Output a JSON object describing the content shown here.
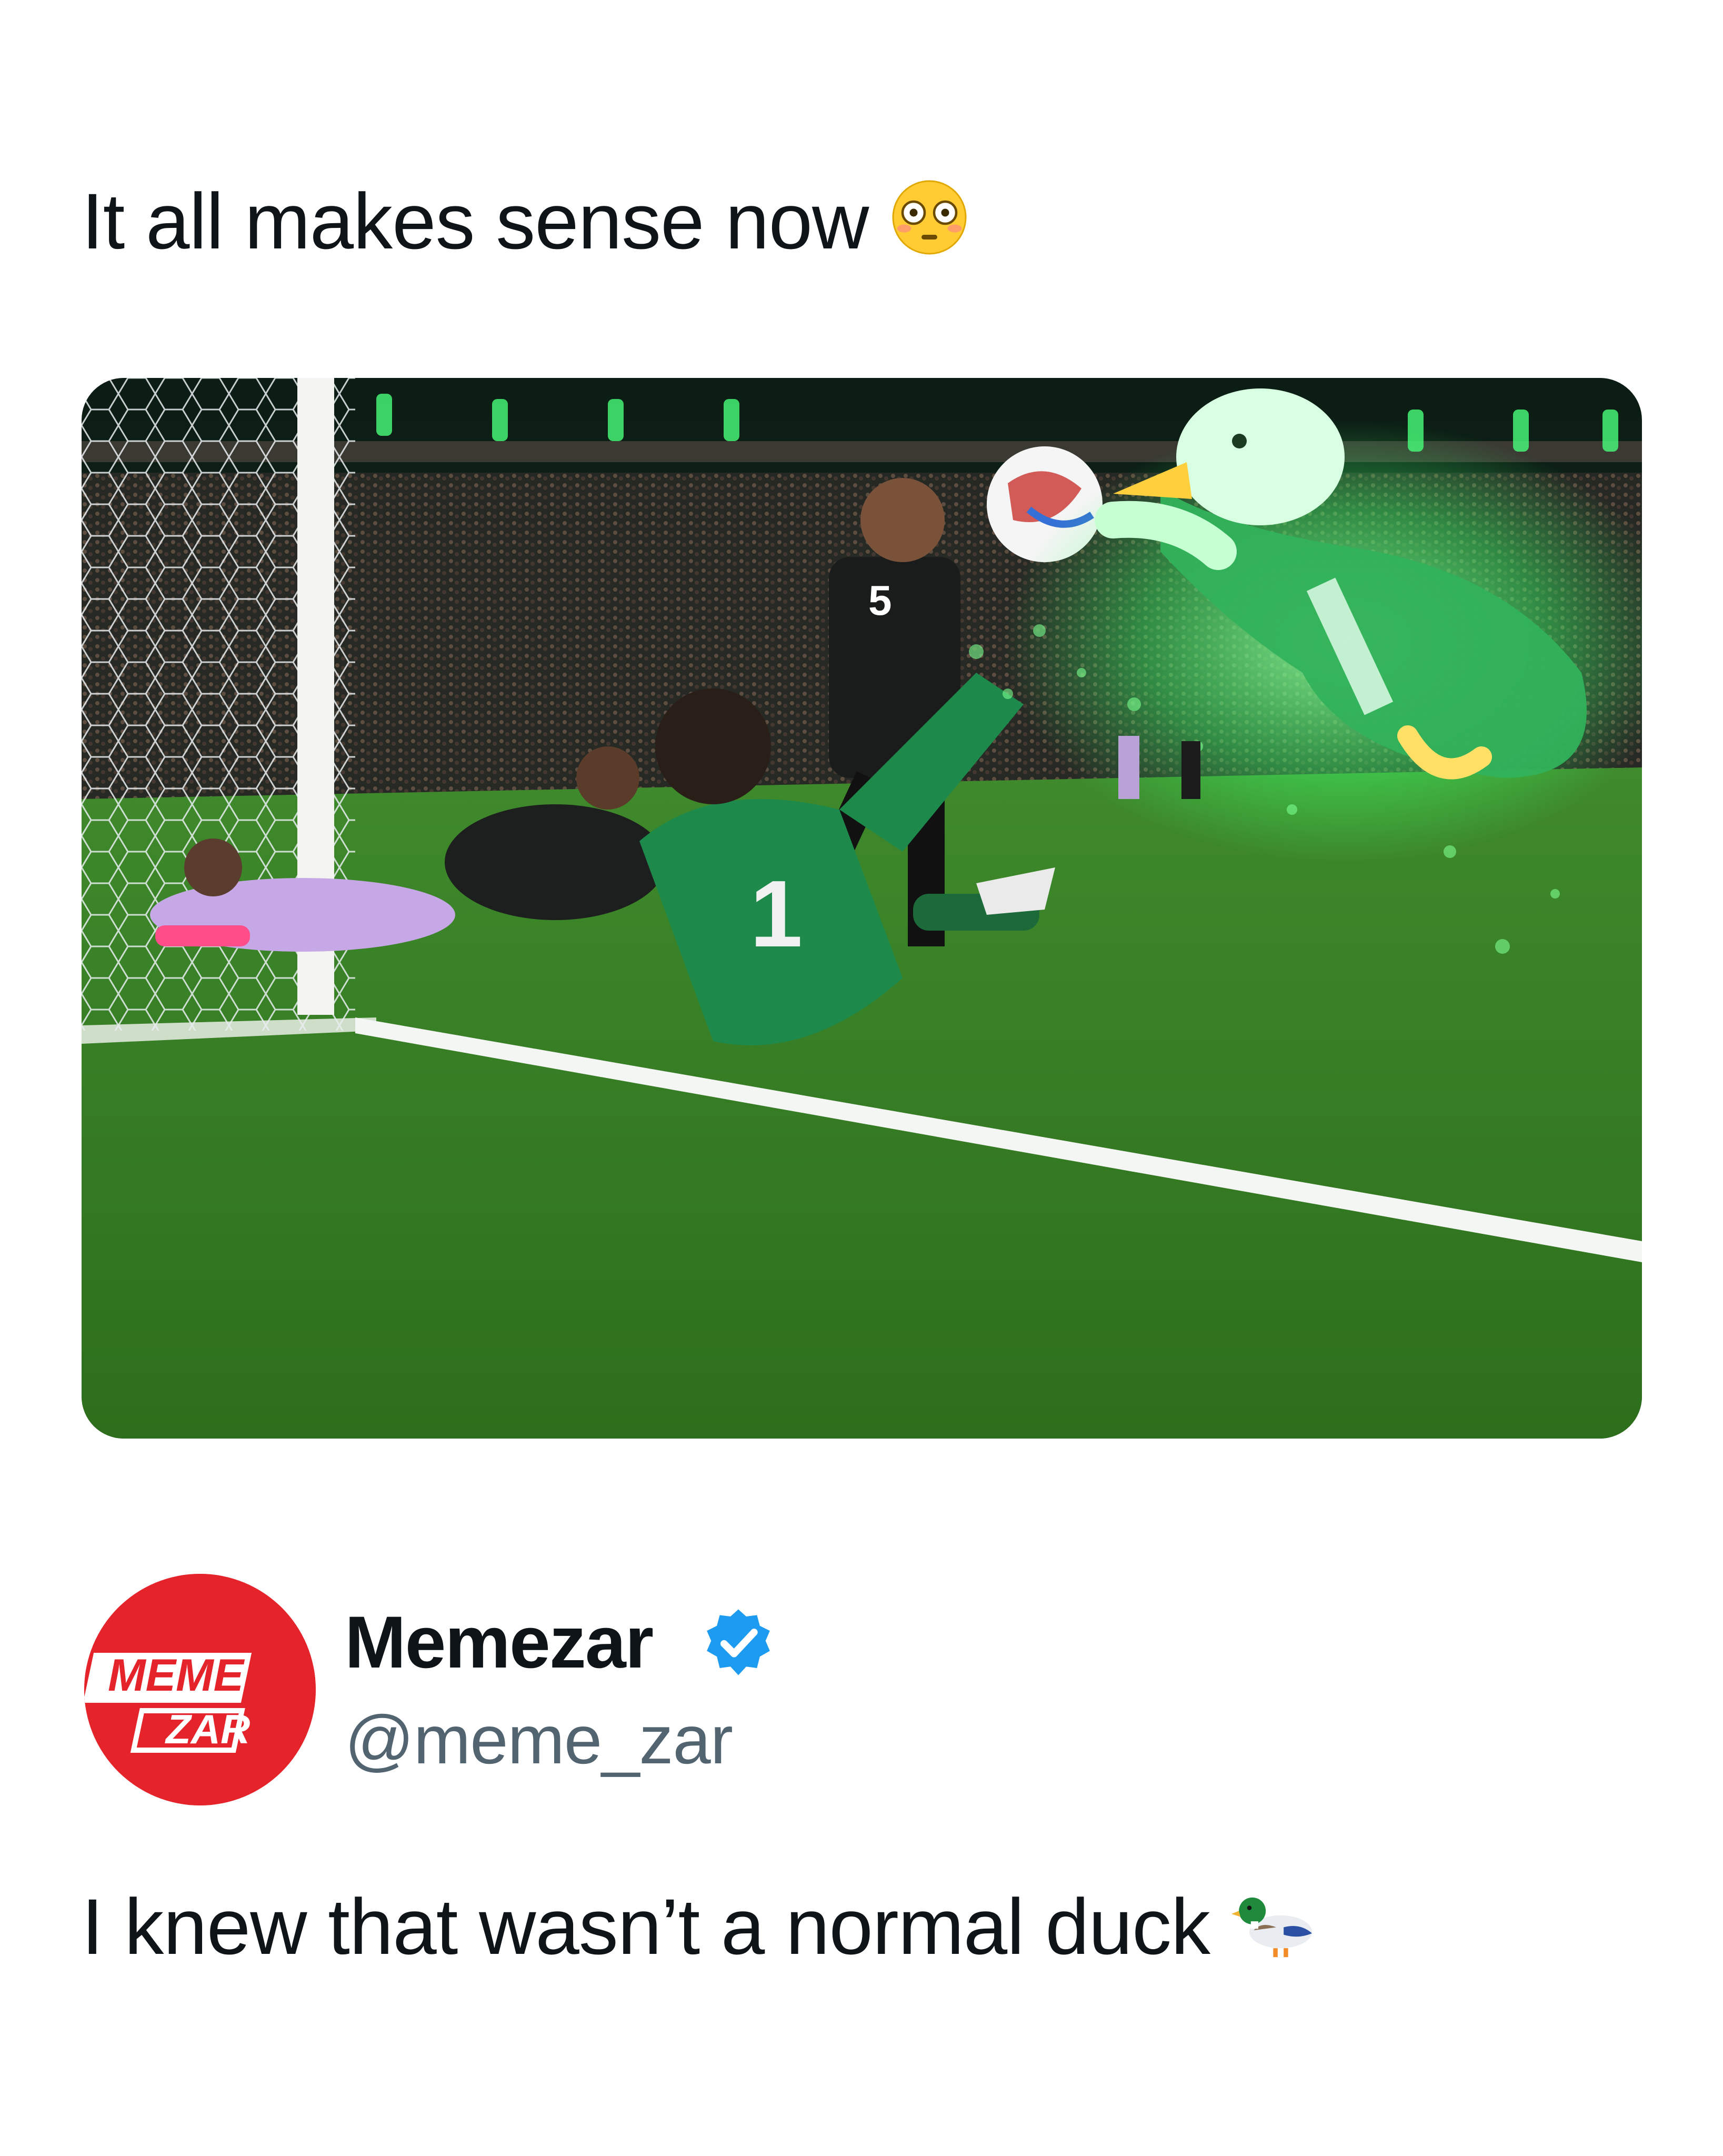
{
  "post": {
    "caption_top": "It all makes sense now",
    "caption_top_emoji": "flushed-face-icon",
    "image_alt": "Goalkeeper diving for the ball with a glowing green duck in a Mexico kit"
  },
  "account": {
    "avatar_text_line1": "MEME",
    "avatar_text_line2": "ZAR",
    "name": "Memezar",
    "handle": "@meme_zar",
    "verified_icon": "verified-badge-icon",
    "verified_color": "#1d9bf0"
  },
  "reply": {
    "text": "I knew that wasn’t a normal duck",
    "emoji": "duck-icon"
  }
}
